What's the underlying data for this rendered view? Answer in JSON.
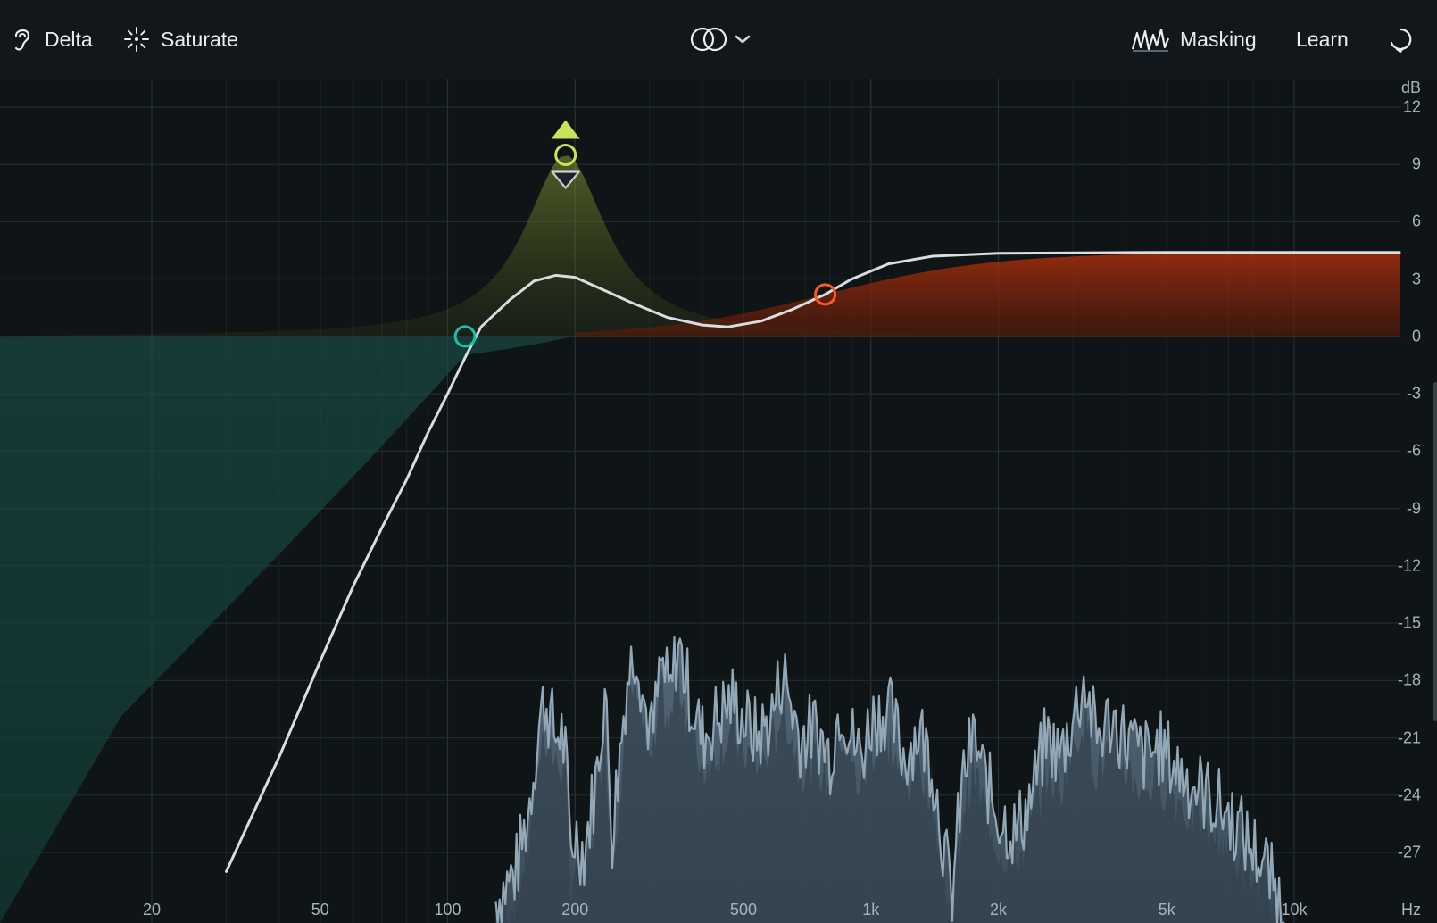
{
  "toolbar": {
    "delta_label": "Delta",
    "saturate_label": "Saturate",
    "masking_label": "Masking",
    "learn_label": "Learn"
  },
  "icons": {
    "delta": "ear-icon",
    "saturate": "sparkle-icon",
    "stereo": "stereo-link-icon",
    "dropdown": "chevron-down-icon",
    "masking": "masking-waveform-icon",
    "undo": "refresh-icon"
  },
  "colors": {
    "background": "#0f1416",
    "curve": "#d9dde0",
    "band_low_cut": "#17c2a8",
    "band_bell": "#c8e45a",
    "band_high_shelf": "#ff5a1e",
    "spectrum": "#8fa3b1"
  },
  "chart_data": {
    "type": "area",
    "title": "",
    "xlabel": "Hz",
    "ylabel": "dB",
    "x_scale": "log",
    "xlim": [
      17,
      20000
    ],
    "ylim": [
      -29,
      13
    ],
    "grid": true,
    "x_ticks": [
      {
        "value": 20,
        "label": "20"
      },
      {
        "value": 50,
        "label": "50"
      },
      {
        "value": 100,
        "label": "100"
      },
      {
        "value": 200,
        "label": "200"
      },
      {
        "value": 500,
        "label": "500"
      },
      {
        "value": 1000,
        "label": "1k"
      },
      {
        "value": 2000,
        "label": "2k"
      },
      {
        "value": 5000,
        "label": "5k"
      },
      {
        "value": 10000,
        "label": "10k"
      }
    ],
    "y_ticks": [
      {
        "value": 12,
        "label": "12"
      },
      {
        "value": 9,
        "label": "9"
      },
      {
        "value": 6,
        "label": "6"
      },
      {
        "value": 3,
        "label": "3"
      },
      {
        "value": 0,
        "label": "0"
      },
      {
        "value": -3,
        "label": "-3"
      },
      {
        "value": -6,
        "label": "-6"
      },
      {
        "value": -9,
        "label": "-9"
      },
      {
        "value": -12,
        "label": "-12"
      },
      {
        "value": -15,
        "label": "-15"
      },
      {
        "value": -18,
        "label": "-18"
      },
      {
        "value": -21,
        "label": "-21"
      },
      {
        "value": -24,
        "label": "-24"
      },
      {
        "value": -27,
        "label": "-27"
      }
    ],
    "bands": [
      {
        "type": "low-cut",
        "freq": 110,
        "gain": 0,
        "color": "#17c2a8"
      },
      {
        "type": "bell",
        "freq": 190,
        "gain": 9.5,
        "q": 1.6,
        "color": "#c8e45a"
      },
      {
        "type": "high-shelf",
        "freq": 780,
        "gain": 4.4,
        "color": "#ff5a1e"
      }
    ],
    "combined_curve": [
      [
        30,
        -28
      ],
      [
        40,
        -22
      ],
      [
        50,
        -17
      ],
      [
        60,
        -13
      ],
      [
        70,
        -10
      ],
      [
        80,
        -7.5
      ],
      [
        90,
        -5
      ],
      [
        100,
        -3
      ],
      [
        110,
        -1.1
      ],
      [
        120,
        0.5
      ],
      [
        140,
        1.9
      ],
      [
        160,
        2.9
      ],
      [
        180,
        3.2
      ],
      [
        200,
        3.1
      ],
      [
        230,
        2.5
      ],
      [
        270,
        1.8
      ],
      [
        330,
        1.0
      ],
      [
        400,
        0.6
      ],
      [
        460,
        0.5
      ],
      [
        550,
        0.8
      ],
      [
        650,
        1.4
      ],
      [
        780,
        2.2
      ],
      [
        900,
        3.0
      ],
      [
        1100,
        3.8
      ],
      [
        1400,
        4.2
      ],
      [
        2000,
        4.35
      ],
      [
        5000,
        4.4
      ],
      [
        20000,
        4.4
      ]
    ],
    "spectrum": [
      [
        130,
        -29.5
      ],
      [
        145,
        -28
      ],
      [
        155,
        -25
      ],
      [
        165,
        -20
      ],
      [
        170,
        -19
      ],
      [
        175,
        -20
      ],
      [
        180,
        -21
      ],
      [
        185,
        -20.5
      ],
      [
        190,
        -22
      ],
      [
        195,
        -27
      ],
      [
        200,
        -26
      ],
      [
        210,
        -27
      ],
      [
        225,
        -23
      ],
      [
        235,
        -18.5
      ],
      [
        245,
        -26
      ],
      [
        265,
        -18
      ],
      [
        280,
        -16
      ],
      [
        290,
        -19
      ],
      [
        305,
        -21
      ],
      [
        320,
        -17
      ],
      [
        335,
        -19
      ],
      [
        350,
        -16
      ],
      [
        375,
        -19
      ],
      [
        400,
        -21
      ],
      [
        430,
        -20
      ],
      [
        470,
        -19
      ],
      [
        500,
        -20
      ],
      [
        540,
        -21
      ],
      [
        580,
        -20
      ],
      [
        620,
        -17.5
      ],
      [
        680,
        -21
      ],
      [
        740,
        -20.5
      ],
      [
        800,
        -22
      ],
      [
        850,
        -19
      ],
      [
        900,
        -21
      ],
      [
        950,
        -22
      ],
      [
        1000,
        -20
      ],
      [
        1100,
        -19.5
      ],
      [
        1200,
        -22
      ],
      [
        1300,
        -20.5
      ],
      [
        1400,
        -22.5
      ],
      [
        1550,
        -29.5
      ],
      [
        1650,
        -23
      ],
      [
        1750,
        -21
      ],
      [
        1850,
        -23
      ],
      [
        2000,
        -25
      ],
      [
        2200,
        -26
      ],
      [
        2400,
        -24
      ],
      [
        2600,
        -21
      ],
      [
        2800,
        -22
      ],
      [
        3000,
        -20
      ],
      [
        3200,
        -18
      ],
      [
        3400,
        -21
      ],
      [
        3700,
        -20
      ],
      [
        4000,
        -21
      ],
      [
        4400,
        -22
      ],
      [
        4800,
        -21.5
      ],
      [
        5500,
        -23
      ],
      [
        6200,
        -24
      ],
      [
        7000,
        -25
      ],
      [
        7800,
        -26.5
      ],
      [
        8500,
        -27.5
      ],
      [
        9000,
        -29
      ],
      [
        9500,
        -30
      ]
    ]
  }
}
